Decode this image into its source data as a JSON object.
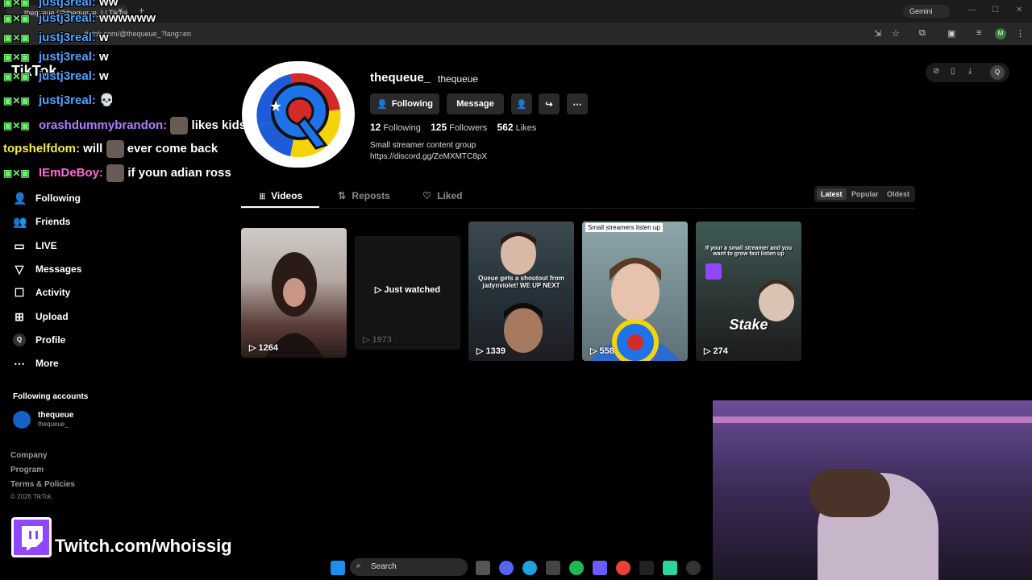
{
  "browser": {
    "tab_title": "thequeue (@thequeue_) | TikTok",
    "tab_close": "×",
    "new_tab": "+",
    "gemini_label": "Gemini",
    "url": "tiktok.com/@thequeue_?lang=en"
  },
  "chat": {
    "messages": [
      {
        "user": "justj3real:",
        "text": "ww"
      },
      {
        "user": "justj3real:",
        "text": "wwwwww"
      },
      {
        "user": "justj3real:",
        "text": "w"
      },
      {
        "user": "justj3real:",
        "text": "w"
      },
      {
        "user": "justj3real:",
        "text": "w"
      },
      {
        "user": "justj3real:",
        "text": "💀"
      },
      {
        "user": "orashdummybrandon:",
        "text": "likes kids"
      },
      {
        "user": "topshelfdom:",
        "text": "will",
        "text2": "ever come back"
      },
      {
        "user": "IEmDeBoy:",
        "text": "if youn adian ross"
      }
    ],
    "tiktok_logo": "TikTok"
  },
  "sidebar": {
    "items": [
      {
        "label": "Following",
        "icon": "person-icon"
      },
      {
        "label": "Friends",
        "icon": "friends-icon"
      },
      {
        "label": "LIVE",
        "icon": "live-icon"
      },
      {
        "label": "Messages",
        "icon": "paper-plane-icon"
      },
      {
        "label": "Activity",
        "icon": "bell-icon"
      },
      {
        "label": "Upload",
        "icon": "plus-icon"
      },
      {
        "label": "Profile",
        "icon": "profile-icon"
      },
      {
        "label": "More",
        "icon": "ellipsis-icon"
      }
    ],
    "profile_icon_letter": "Q",
    "following_accounts_heading": "Following accounts",
    "account": {
      "name": "thequeue",
      "handle": "thequeue_"
    },
    "footer": [
      "Company",
      "Program",
      "Terms & Policies"
    ],
    "copyright": "© 2026 TikTok"
  },
  "profile": {
    "username": "thequeue_",
    "nickname": "thequeue",
    "buttons": {
      "following": "Following",
      "message": "Message"
    },
    "stats": {
      "following_count": "12",
      "following_label": "Following",
      "followers_count": "125",
      "followers_label": "Followers",
      "likes_count": "562",
      "likes_label": "Likes"
    },
    "bio": "Small streamer content group",
    "bio_link": "https://discord.gg/ZeMXMTC8pX"
  },
  "tabs": {
    "videos": "Videos",
    "reposts": "Reposts",
    "liked": "Liked"
  },
  "sort": {
    "latest": "Latest",
    "popular": "Popular",
    "oldest": "Oldest"
  },
  "videos": [
    {
      "views": "1264"
    },
    {
      "views": "1973",
      "overlay": "Just watched"
    },
    {
      "views": "1339",
      "caption": "Queue gets a shoutout from jadynviolet! WE UP NEXT"
    },
    {
      "views": "558",
      "top_caption": "Small streamers listen up"
    },
    {
      "views": "274",
      "caption": "If your a small streamer and you want to grow fast listen up",
      "sponsor": "Stake"
    }
  ],
  "toolbar_q": "Q",
  "twitch": {
    "text": "Twitch.com/whoissig"
  },
  "taskbar": {
    "search": "Search"
  },
  "colors": {
    "accent_blue": "#4fa3ff",
    "twitch_purple": "#9146ff",
    "avatar_blue": "#1663c7"
  }
}
